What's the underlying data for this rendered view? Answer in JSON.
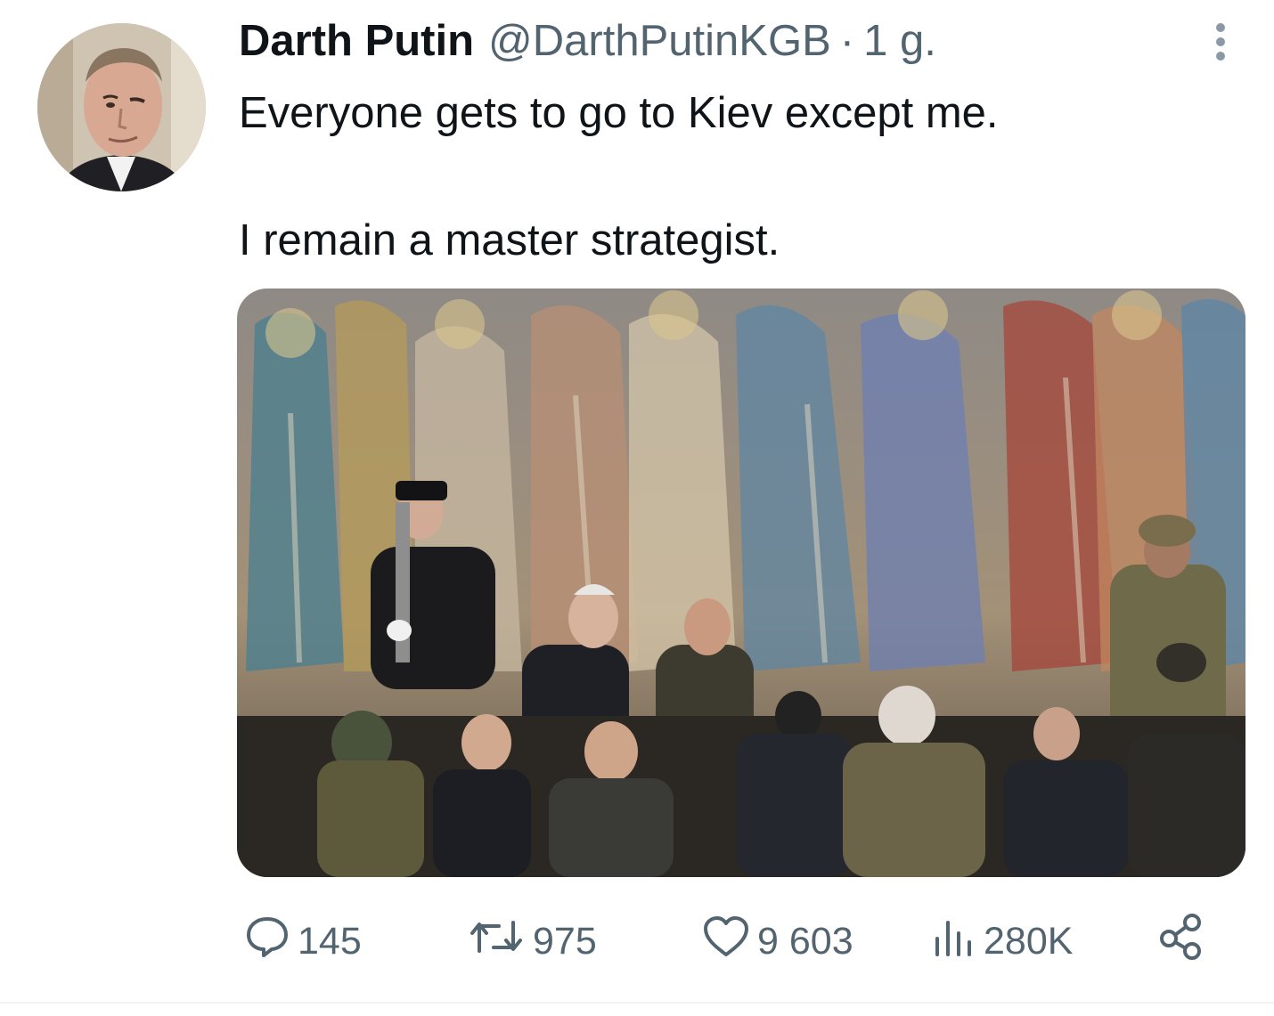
{
  "tweet": {
    "author_name": "Darth Putin",
    "author_handle": "@DarthPutinKGB",
    "separator": "·",
    "time": "1 g.",
    "text_line1": "Everyone gets to go to Kiev except me.",
    "text_line2": "I remain a master strategist."
  },
  "actions": {
    "replies": "145",
    "retweets": "975",
    "likes": "9 603",
    "views": "280K"
  },
  "icons": {
    "reply": "speech-bubble-icon",
    "retweet": "retweet-icon",
    "like": "heart-icon",
    "views": "bar-chart-icon",
    "share": "share-icon",
    "more": "more-vertical-icon"
  },
  "colors": {
    "text": "#0f1419",
    "secondary": "#536471",
    "divider": "#eff3f4"
  }
}
